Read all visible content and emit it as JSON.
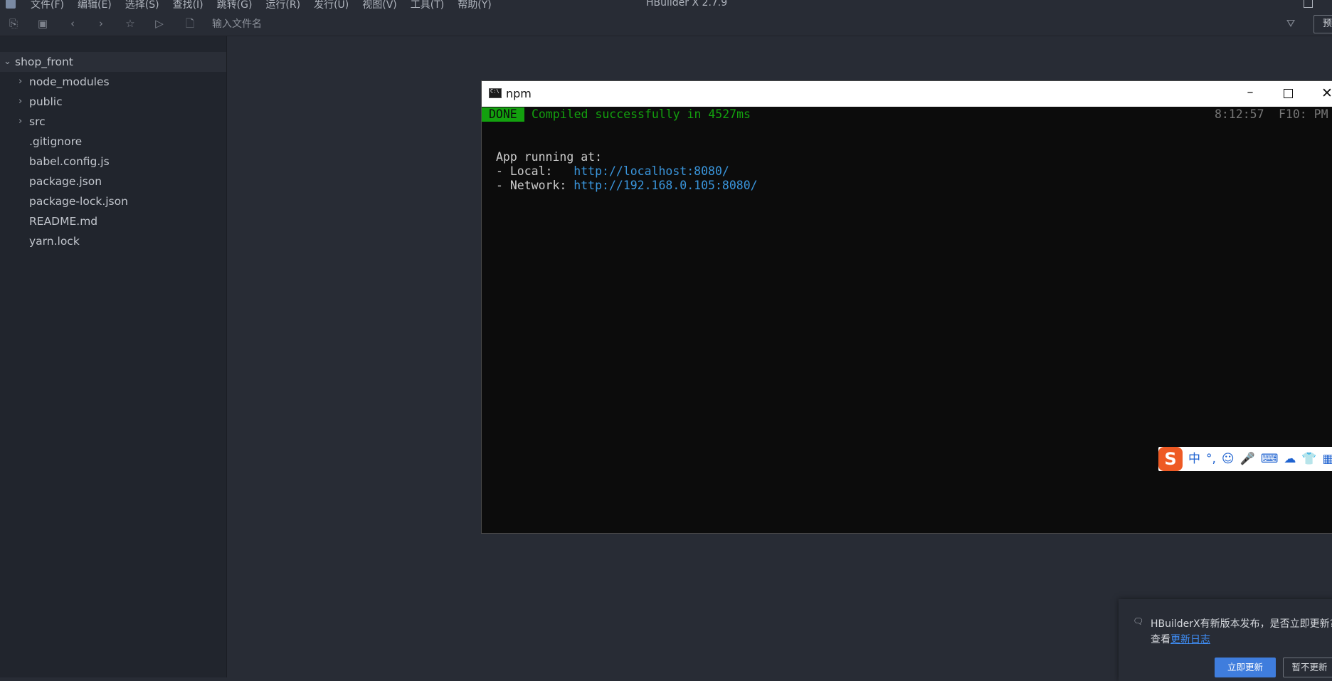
{
  "menubar": {
    "items": [
      "文件(F)",
      "编辑(E)",
      "选择(S)",
      "查找(I)",
      "跳转(G)",
      "运行(R)",
      "发行(U)",
      "视图(V)",
      "工具(T)",
      "帮助(Y)"
    ],
    "app_title": "HBuilder X 2.7.9"
  },
  "toolbar": {
    "icons": [
      "new-file-icon",
      "save-icon",
      "back-icon",
      "forward-icon",
      "star-icon",
      "run-icon",
      "file-search-icon",
      "filter-icon"
    ],
    "filename_placeholder": "输入文件名",
    "preview_label": "预览"
  },
  "sidebar": {
    "project": "shop_front",
    "items": [
      {
        "label": "node_modules",
        "type": "folder"
      },
      {
        "label": "public",
        "type": "folder"
      },
      {
        "label": "src",
        "type": "folder"
      },
      {
        "label": ".gitignore",
        "type": "file"
      },
      {
        "label": "babel.config.js",
        "type": "file"
      },
      {
        "label": "package.json",
        "type": "file"
      },
      {
        "label": "package-lock.json",
        "type": "file"
      },
      {
        "label": "README.md",
        "type": "file"
      },
      {
        "label": "yarn.lock",
        "type": "file"
      }
    ]
  },
  "npm_window": {
    "title": "npm",
    "done_badge": "DONE",
    "compiled_msg": "Compiled successfully in 4527ms",
    "time": "8:12:57",
    "f10_text": "F10: PM",
    "app_running": "App running at:",
    "local_label": "- Local:   ",
    "local_url": "http://localhost:8080/",
    "network_label": "- Network: ",
    "network_url": "http://192.168.0.105:8080/"
  },
  "ime": {
    "logo": "S",
    "items": [
      "中",
      "°,",
      "☺",
      "🎤",
      "⌨",
      "☁",
      "👕",
      "▦"
    ]
  },
  "notification": {
    "line1": "HBuilderX有新版本发布，是否立即更新?",
    "line2_prefix": "查看",
    "line2_link": "更新日志",
    "update_now": "立即更新",
    "update_later": "暂不更新"
  },
  "colors": {
    "bg": "#282c35",
    "sidebar_bg": "#21252d",
    "terminal_bg": "#0c0c0c",
    "done_green": "#13a10e",
    "link_blue": "#3a96dd",
    "button_blue": "#3f7ddd"
  }
}
